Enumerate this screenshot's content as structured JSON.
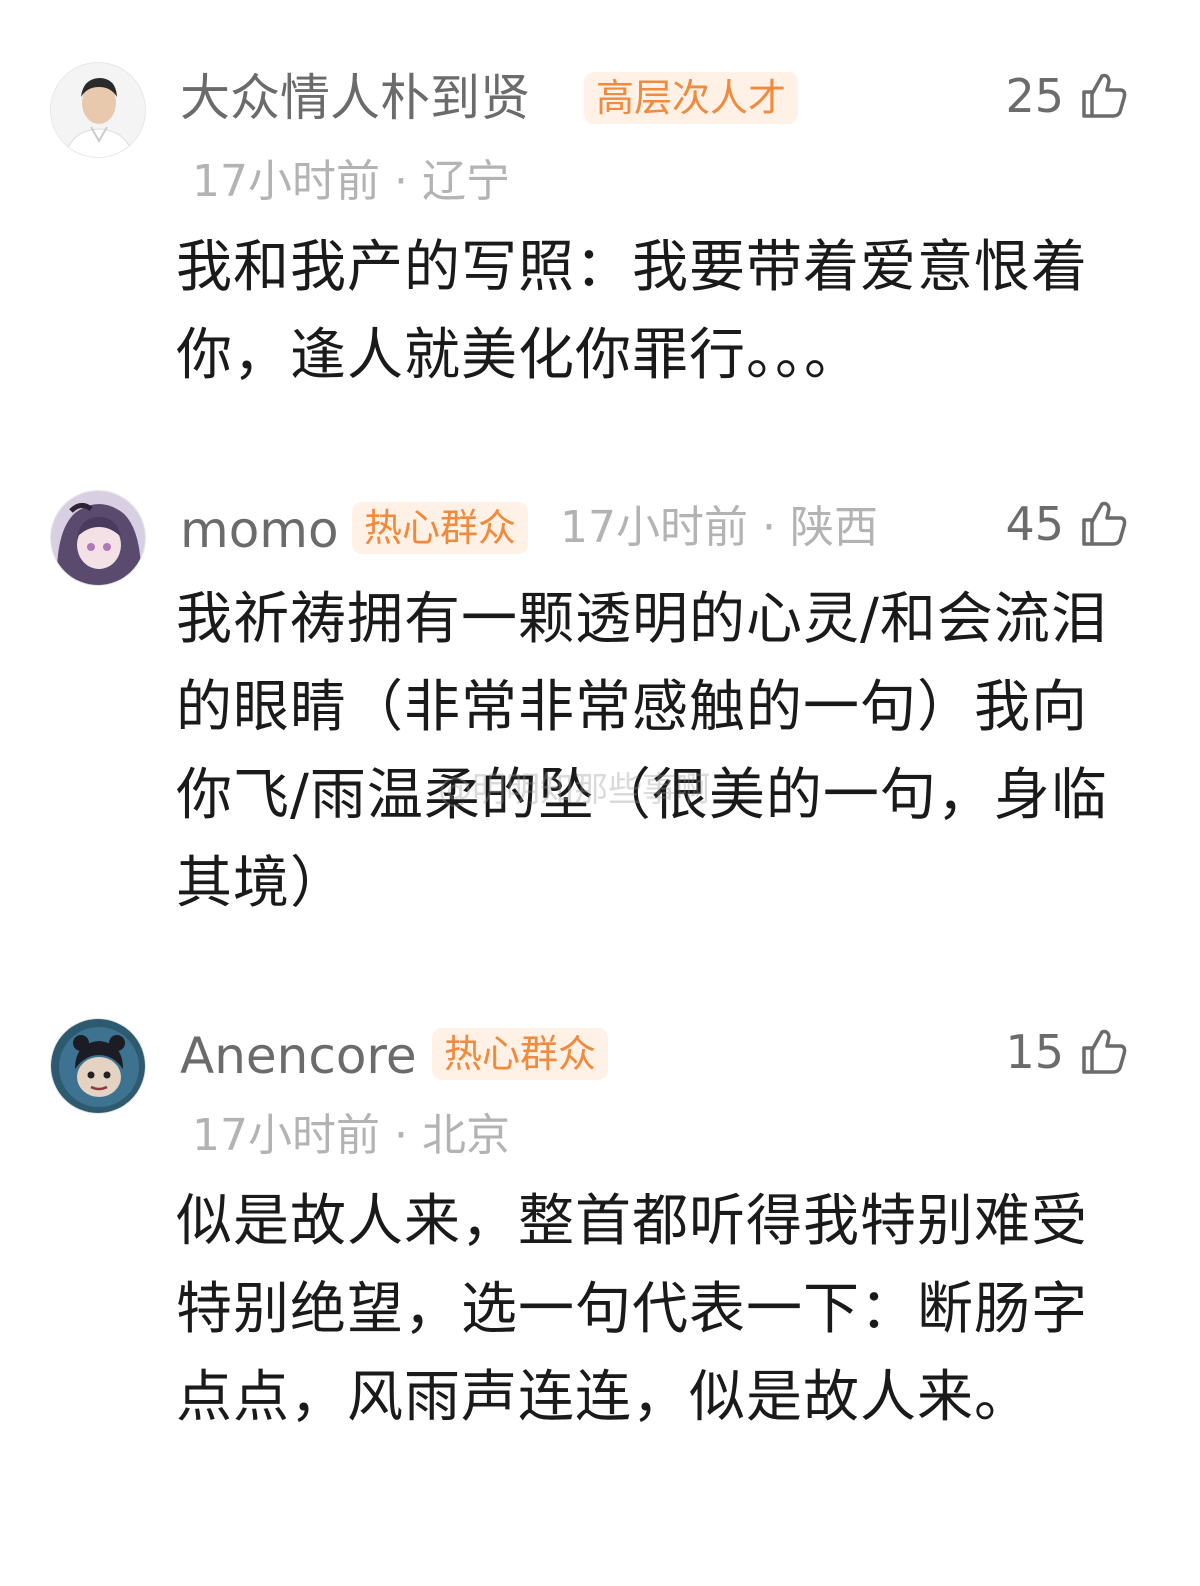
{
  "comments": [
    {
      "username": "大众情人朴到贤",
      "badge": "高层次人才",
      "meta": "17小时前 · 辽宁",
      "likes": "25",
      "content": "我和我产的写照：我要带着爱意恨着你，逢人就美化你罪行。。。",
      "avatar": "man-portrait"
    },
    {
      "username": "momo",
      "badge": "热心群众",
      "meta": "17小时前 · 陕西",
      "likes": "45",
      "content": "我祈祷拥有一颗透明的心灵/和会流泪的眼睛（非常非常感触的一句）我向你飞/雨温柔的坠（很美的一句，身临其境）",
      "avatar": "anime-girl"
    },
    {
      "username": "Anencore",
      "badge": "热心群众",
      "meta": "17小时前 · 北京",
      "likes": "15",
      "content": "似是故人来，整首都听得我特别难受特别绝望，选一句代表一下：断肠字点点，风雨声连连，似是故人来。",
      "avatar": "cartoon-character"
    }
  ],
  "watermark": "@明明知那些事啊",
  "colors": {
    "badge_bg": "#fff1e6",
    "badge_text": "#f08a3c",
    "username": "#6b6b6b",
    "meta": "#b3b3b3",
    "content": "#1a1a1a"
  }
}
